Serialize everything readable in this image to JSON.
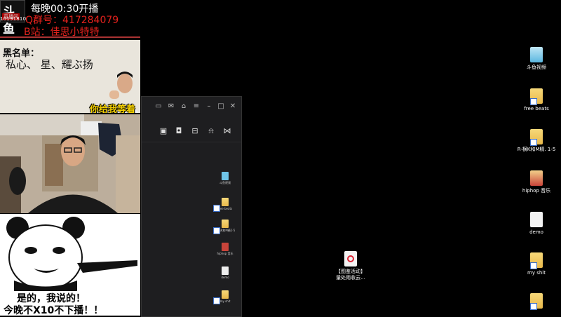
{
  "overlay": {
    "logo_text": "斗鱼",
    "logo_sub": "直播间",
    "room_id": "10191810",
    "schedule": "每晚00:30开播",
    "qq_group": "Q群号：417284079",
    "bilibili": "B站：佳思小特特"
  },
  "panel1": {
    "title": "黑名单：",
    "names": "私心、 星、耀ぶ扬",
    "caption": "你给我等着"
  },
  "meme": {
    "line1": "是的，我说的！",
    "line2": "今晚不X10不下播！！"
  },
  "window": {
    "title_buttons": [
      "screen-icon",
      "mail-icon",
      "shirt-icon",
      "menu-icon",
      "minimize-icon",
      "maximize-icon",
      "close-icon"
    ],
    "toolbar_buttons": [
      "gift-icon",
      "lock-icon",
      "layout-icon",
      "bell-icon",
      "share-icon"
    ],
    "mini_icons": [
      {
        "label": "斗鱼视频",
        "kind": "app"
      },
      {
        "label": "free beats",
        "kind": "folder"
      },
      {
        "label": "R-横K和M精1-5",
        "kind": "folder"
      },
      {
        "label": "hiphop 音乐",
        "kind": "app"
      },
      {
        "label": "demo",
        "kind": "app"
      },
      {
        "label": "my shit",
        "kind": "folder"
      }
    ]
  },
  "desktop": {
    "icons": [
      {
        "label": "斗鱼视频",
        "kind": "app"
      },
      {
        "label": "free beats",
        "kind": "folder"
      },
      {
        "label": "R-横K和M精. 1-5",
        "kind": "folder"
      },
      {
        "label": "hiphop 音乐",
        "kind": "app"
      },
      {
        "label": "demo",
        "kind": "app"
      },
      {
        "label": "my shit",
        "kind": "folder"
      },
      {
        "label": "",
        "kind": "folder"
      }
    ],
    "center_file": {
      "label": "【图鉴活动】\n量处雨收云...",
      "kind": "doc"
    }
  },
  "colors": {
    "background": "#000000",
    "accent_red": "#e5221d",
    "caption_yellow": "#f5d000"
  }
}
